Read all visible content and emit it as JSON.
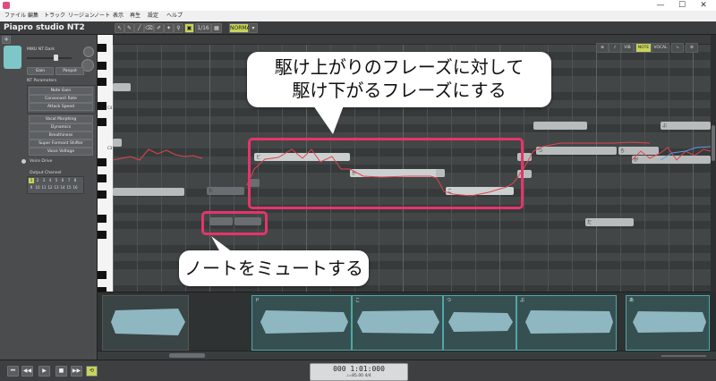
{
  "window": {
    "minimize": "—",
    "maximize": "☐",
    "close": "✕"
  },
  "menu": [
    "ファイル",
    "編集",
    "トラック",
    "リージョン",
    "ノート",
    "表示",
    "再生",
    "設定",
    "ヘルプ"
  ],
  "app": {
    "logo": "Piapro studio NT2"
  },
  "toolbar": {
    "snap": "1/16",
    "mode": "NORMAL"
  },
  "singer": {
    "name": "MIKU NT Dark",
    "buttons": [
      "Gain",
      "Panpot"
    ]
  },
  "nt_parameters": {
    "header": "NT Parameters",
    "items": [
      "Note Gain",
      "Consonant Rate",
      "Attack Speed",
      "Vocal Morphing",
      "Dynamics",
      "Breathiness",
      "Super Formant Shifter",
      "Voice Voltage"
    ]
  },
  "voice_drive": "Voice Drive",
  "output_channel": {
    "label": "Output Channel",
    "channels": [
      "1",
      "2",
      "3",
      "4",
      "5",
      "6",
      "7",
      "8",
      "9",
      "10",
      "11",
      "12",
      "13",
      "14",
      "15",
      "16"
    ]
  },
  "editor": {
    "octave_labels": [
      "C4",
      "C3"
    ],
    "tools": [
      "VIB",
      "DYN",
      "NOTE",
      "VOCAL"
    ]
  },
  "note_labels": [
    "た",
    "ど",
    "か",
    "こ",
    "ー",
    "つ",
    "だ",
    "ら",
    "ぶ",
    "が"
  ],
  "waveform_labels": [
    "ド",
    "こ",
    "つ",
    "ぶ",
    "あ"
  ],
  "transport": {
    "buttons": [
      "⏮",
      "◀◀",
      "▶",
      "■",
      "▶▶",
      "⟲"
    ],
    "time": "000 1:01:000",
    "tempo": "♩=85.00  4/4"
  },
  "annotations": {
    "callout_top_line1": "駆け上がりのフレーズに対して",
    "callout_top_line2": "駆け下がるフレーズにする",
    "callout_bottom": "ノートをミュートする"
  },
  "colors": {
    "highlight": "#e5356b",
    "pitch_curve": "#e0454f",
    "accent": "#c8d45a"
  }
}
